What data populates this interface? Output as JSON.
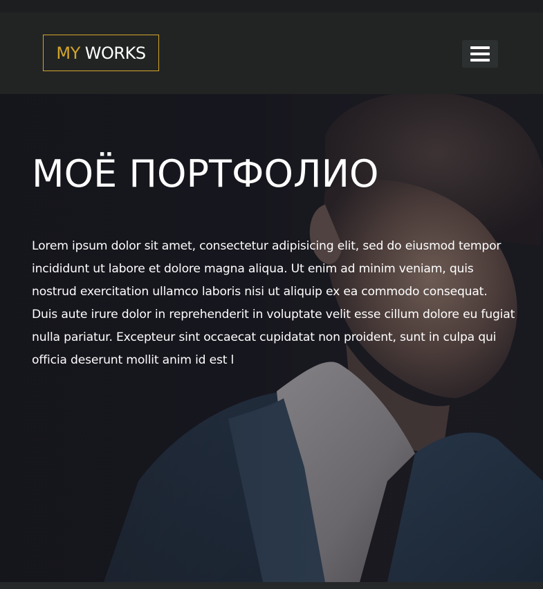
{
  "header": {
    "logo": {
      "prefix": "MY",
      "name": "WORKS"
    },
    "menu_icon": "hamburger-menu-icon"
  },
  "hero": {
    "title": "МОЁ ПОРТФОЛИО",
    "text": "Lorem ipsum dolor sit amet, consectetur adipisicing elit, sed do eiusmod tempor incididunt ut labore et dolore magna aliqua. Ut enim ad minim veniam, quis nostrud exercitation ullamco laboris nisi ut aliquip ex ea commodo consequat. Duis aute irure dolor in reprehenderit in voluptate velit esse cillum dolore eu fugiat nulla pariatur. Excepteur sint occaecat cupidatat non proident, sunt in culpa qui officia deserunt mollit anim id est l",
    "background_image": "portrait-man-in-suit"
  },
  "colors": {
    "accent": "#d4a52a",
    "header_bg": "#222424",
    "hero_bg": "#16161d",
    "text": "#ffffff"
  }
}
